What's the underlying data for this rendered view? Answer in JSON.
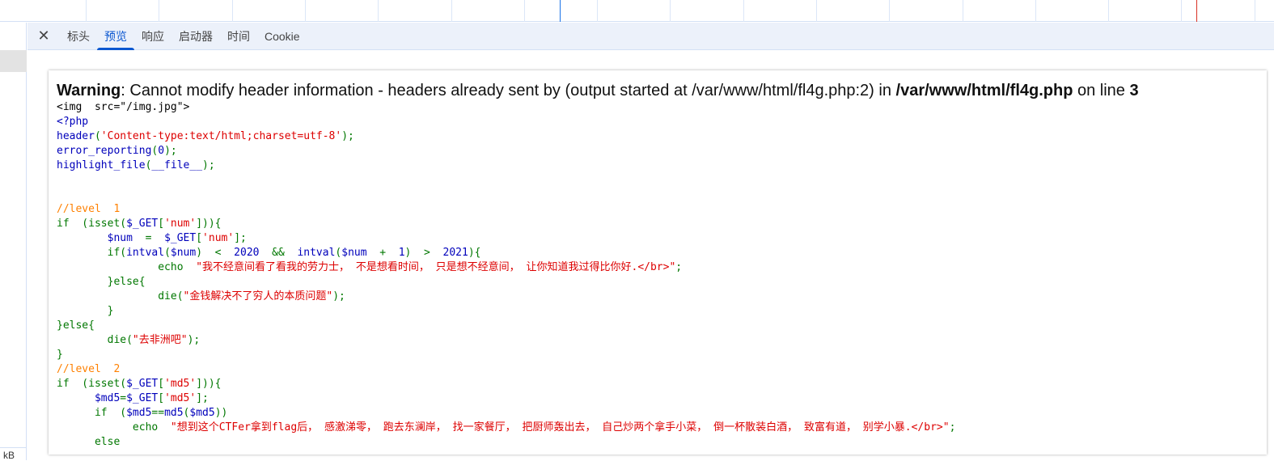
{
  "tabs": {
    "close_icon": "close-icon",
    "items": [
      "标头",
      "预览",
      "响应",
      "启动器",
      "时间",
      "Cookie"
    ],
    "active": 1
  },
  "footer": {
    "size_unit": "kB"
  },
  "warning": {
    "label": "Warning",
    "sep": ": ",
    "message": "Cannot modify header information - headers already sent by (output started at /var/www/html/fl4g.php:2) in ",
    "file": "/var/www/html/fl4g.php",
    "on_line": " on line ",
    "line": "3"
  },
  "colors": {
    "accent": "#0b57d0",
    "html": "#0000bb",
    "keyword": "#007700",
    "string": "#dd0000",
    "comment": "#ff8000"
  },
  "code": [
    [
      [
        "<img  src=\"/img.jpg\">",
        "k"
      ]
    ],
    [
      [
        "<?php",
        "b"
      ]
    ],
    [
      [
        "header",
        "b"
      ],
      [
        "(",
        "g"
      ],
      [
        "'Content-type:text/html;charset=utf-8'",
        "r"
      ],
      [
        ");",
        "g"
      ]
    ],
    [
      [
        "error_reporting",
        "b"
      ],
      [
        "(",
        "g"
      ],
      [
        "0",
        "b"
      ],
      [
        ");",
        "g"
      ]
    ],
    [
      [
        "highlight_file",
        "b"
      ],
      [
        "(",
        "g"
      ],
      [
        "__file__",
        "b"
      ],
      [
        ");",
        "g"
      ]
    ],
    [
      [
        "",
        ""
      ]
    ],
    [
      [
        "",
        ""
      ]
    ],
    [
      [
        "//level  1",
        "o"
      ]
    ],
    [
      [
        "if  (isset(",
        "g"
      ],
      [
        "$_GET",
        "b"
      ],
      [
        "[",
        "g"
      ],
      [
        "'num'",
        "r"
      ],
      [
        "])){",
        "g"
      ]
    ],
    [
      [
        "        ",
        ""
      ],
      [
        "$num  ",
        "b"
      ],
      [
        "=  ",
        "g"
      ],
      [
        "$_GET",
        "b"
      ],
      [
        "[",
        "g"
      ],
      [
        "'num'",
        "r"
      ],
      [
        "];",
        "g"
      ]
    ],
    [
      [
        "        if(",
        "g"
      ],
      [
        "intval",
        "b"
      ],
      [
        "(",
        "g"
      ],
      [
        "$num",
        "b"
      ],
      [
        ")  <  ",
        "g"
      ],
      [
        "2020  ",
        "b"
      ],
      [
        "&&  ",
        "g"
      ],
      [
        "intval",
        "b"
      ],
      [
        "(",
        "g"
      ],
      [
        "$num  ",
        "b"
      ],
      [
        "+  ",
        "g"
      ],
      [
        "1",
        "b"
      ],
      [
        ")  >  ",
        "g"
      ],
      [
        "2021",
        "b"
      ],
      [
        "){",
        "g"
      ]
    ],
    [
      [
        "                echo  ",
        "g"
      ],
      [
        "\"我不经意间看了看我的劳力士， 不是想看时间， 只是想不经意间， 让你知道我过得比你好.</br>\"",
        "r"
      ],
      [
        ";",
        "g"
      ]
    ],
    [
      [
        "        }else{",
        "g"
      ]
    ],
    [
      [
        "                die(",
        "g"
      ],
      [
        "\"金钱解决不了穷人的本质问题\"",
        "r"
      ],
      [
        ");",
        "g"
      ]
    ],
    [
      [
        "        }",
        "g"
      ]
    ],
    [
      [
        "}else{",
        "g"
      ]
    ],
    [
      [
        "        die(",
        "g"
      ],
      [
        "\"去非洲吧\"",
        "r"
      ],
      [
        ");",
        "g"
      ]
    ],
    [
      [
        "}",
        "g"
      ]
    ],
    [
      [
        "//level  2",
        "o"
      ]
    ],
    [
      [
        "if  (isset(",
        "g"
      ],
      [
        "$_GET",
        "b"
      ],
      [
        "[",
        "g"
      ],
      [
        "'md5'",
        "r"
      ],
      [
        "])){",
        "g"
      ]
    ],
    [
      [
        "      ",
        ""
      ],
      [
        "$md5",
        "b"
      ],
      [
        "=",
        "g"
      ],
      [
        "$_GET",
        "b"
      ],
      [
        "[",
        "g"
      ],
      [
        "'md5'",
        "r"
      ],
      [
        "];",
        "g"
      ]
    ],
    [
      [
        "      if  (",
        "g"
      ],
      [
        "$md5",
        "b"
      ],
      [
        "==",
        "g"
      ],
      [
        "md5",
        "b"
      ],
      [
        "(",
        "g"
      ],
      [
        "$md5",
        "b"
      ],
      [
        "))",
        "g"
      ]
    ],
    [
      [
        "            echo  ",
        "g"
      ],
      [
        "\"想到这个CTFer拿到flag后， 感激涕零， 跑去东澜岸， 找一家餐厅， 把厨师轰出去， 自己炒两个拿手小菜， 倒一杯散装白酒， 致富有道， 别学小暴.</br>\"",
        "r"
      ],
      [
        ";",
        "g"
      ]
    ],
    [
      [
        "      else",
        "g"
      ]
    ]
  ]
}
